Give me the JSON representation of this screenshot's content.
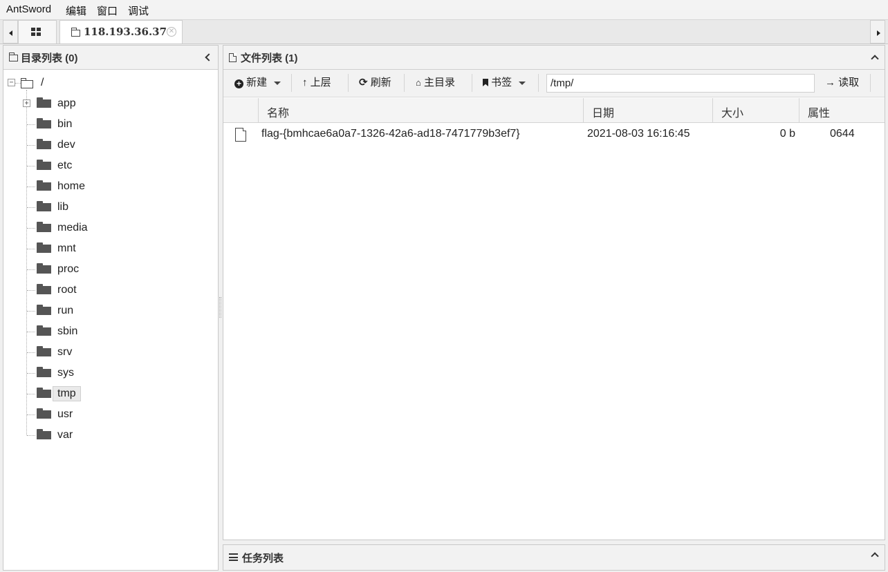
{
  "menu": [
    "AntSword",
    "编辑",
    "窗口",
    "调试"
  ],
  "tabs": {
    "connection_label": "118.193.36.37"
  },
  "left_panel": {
    "title": "目录列表 (0)"
  },
  "tree": {
    "root": "/",
    "items": [
      "app",
      "bin",
      "dev",
      "etc",
      "home",
      "lib",
      "media",
      "mnt",
      "proc",
      "root",
      "run",
      "sbin",
      "srv",
      "sys",
      "tmp",
      "usr",
      "var"
    ],
    "selected": "tmp"
  },
  "file_panel": {
    "title": "文件列表 (1)"
  },
  "toolbar": {
    "new_label": "新建",
    "up_label": "上层",
    "refresh_label": "刷新",
    "home_label": "主目录",
    "bookmark_label": "书签",
    "path_value": "/tmp/",
    "read_label": "读取"
  },
  "table": {
    "headers": {
      "name": "名称",
      "date": "日期",
      "size": "大小",
      "attr": "属性"
    },
    "rows": [
      {
        "name": "flag-{bmhcae6a0a7-1326-42a6-ad18-7471779b3ef7}",
        "date": "2021-08-03 16:16:45",
        "size": "0 b",
        "attr": "0644"
      }
    ]
  },
  "task_panel": {
    "title": "任务列表"
  }
}
